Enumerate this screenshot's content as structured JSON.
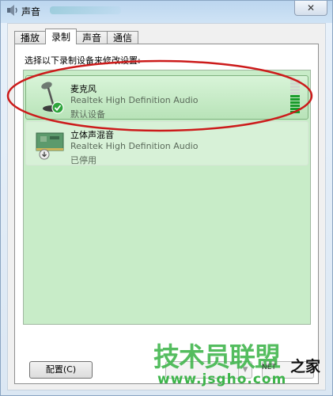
{
  "window": {
    "title": "声音"
  },
  "tabs": [
    {
      "label": "播放",
      "active": false
    },
    {
      "label": "录制",
      "active": true
    },
    {
      "label": "声音",
      "active": false
    },
    {
      "label": "通信",
      "active": false
    }
  ],
  "instruction": "选择以下录制设备来修改设置:",
  "devices": [
    {
      "name": "麦克风",
      "driver": "Realtek High Definition Audio",
      "status": "默认设备",
      "icon": "microphone-icon",
      "selected": true
    },
    {
      "name": "立体声混音",
      "driver": "Realtek High Definition Audio",
      "status": "已停用",
      "icon": "sound-card-icon",
      "selected": false
    }
  ],
  "level_meter": {
    "active_segments": 6,
    "total_segments": 11
  },
  "buttons": {
    "configure": "配置(C)"
  },
  "watermark": {
    "main": "技术员联盟",
    "suffix": "之家",
    "url": "www.jsgho.com",
    "net": "NET"
  },
  "colors": {
    "list_background": "#c8ecc8",
    "annotation_ellipse": "#cc1b1b",
    "watermark_green": "#3db54a",
    "level_on": "#1a9b2c"
  }
}
